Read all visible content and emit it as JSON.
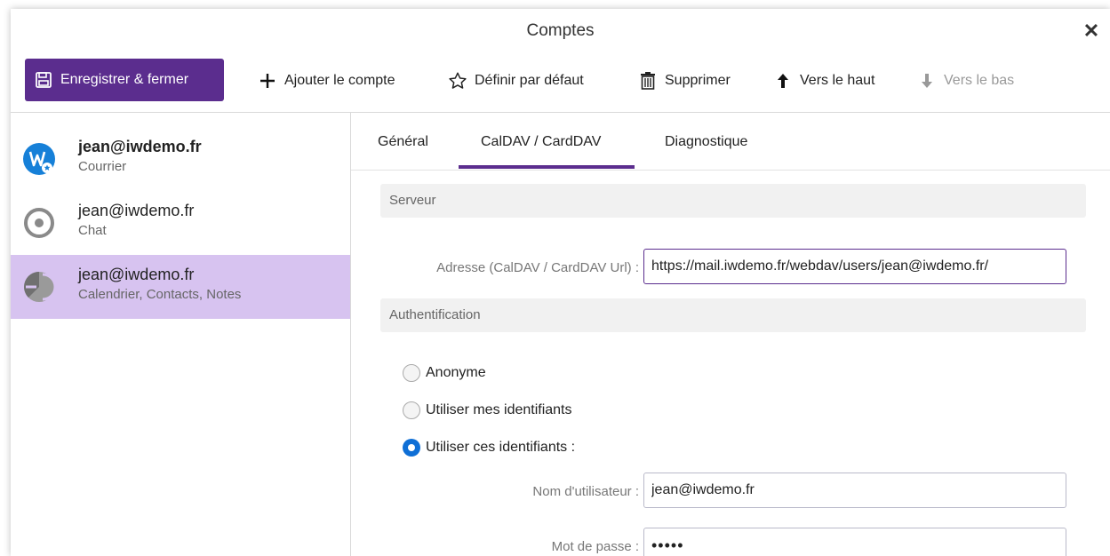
{
  "window": {
    "title": "Comptes"
  },
  "toolbar": {
    "save_close": "Enregistrer & fermer",
    "add_account": "Ajouter le compte",
    "set_default": "Définir par défaut",
    "delete": "Supprimer",
    "move_up": "Vers le haut",
    "move_down": "Vers le bas"
  },
  "accounts": [
    {
      "name": "jean@iwdemo.fr",
      "type": "Courrier"
    },
    {
      "name": "jean@iwdemo.fr",
      "type": "Chat"
    },
    {
      "name": "jean@iwdemo.fr",
      "type": "Calendrier, Contacts, Notes"
    }
  ],
  "tabs": [
    "Général",
    "CalDAV / CardDAV",
    "Diagnostique"
  ],
  "server": {
    "heading": "Serveur",
    "address_label": "Adresse (CalDAV / CardDAV Url) :",
    "address_value": "https://mail.iwdemo.fr/webdav/users/jean@iwdemo.fr/"
  },
  "auth": {
    "heading": "Authentification",
    "options": [
      "Anonyme",
      "Utiliser mes identifiants",
      "Utiliser ces identifiants :"
    ],
    "selected_index": 2,
    "username_label": "Nom d'utilisateur :",
    "username_value": "jean@iwdemo.fr",
    "password_label": "Mot de passe :",
    "password_value": "•••••"
  },
  "colors": {
    "accent": "#5b2d8e",
    "selected_bg": "#d7c3f0",
    "radio_on": "#0f6fd6"
  }
}
